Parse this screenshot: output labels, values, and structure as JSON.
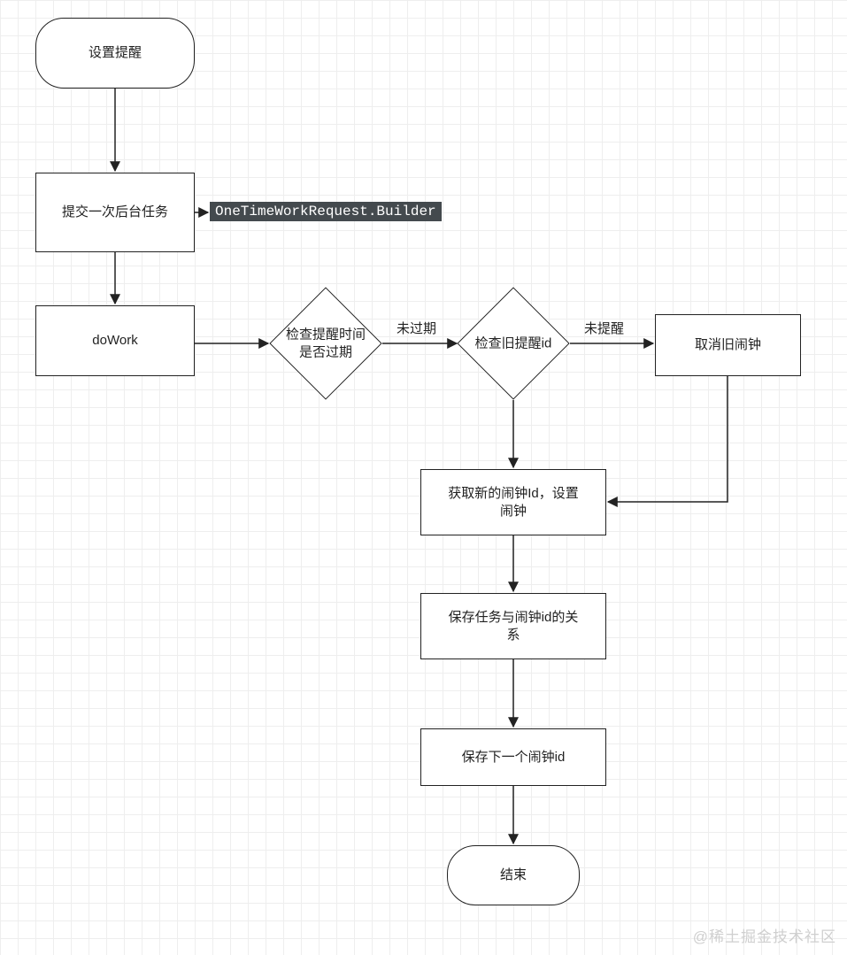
{
  "nodes": {
    "start": "设置提醒",
    "submit": "提交一次后台任务",
    "dowork": "doWork",
    "check_time": "检查提醒时间\n是否过期",
    "check_old": "检查旧提醒id",
    "cancel_old": "取消旧闹钟",
    "get_new": "获取新的闹钟Id，设置\n闹钟",
    "save_rel": "保存任务与闹钟id的关\n系",
    "save_next": "保存下一个闹钟id",
    "end": "结束"
  },
  "labels": {
    "code": "OneTimeWorkRequest.Builder",
    "not_expired": "未过期",
    "not_reminded": "未提醒"
  },
  "watermark": "@稀土掘金技术社区"
}
